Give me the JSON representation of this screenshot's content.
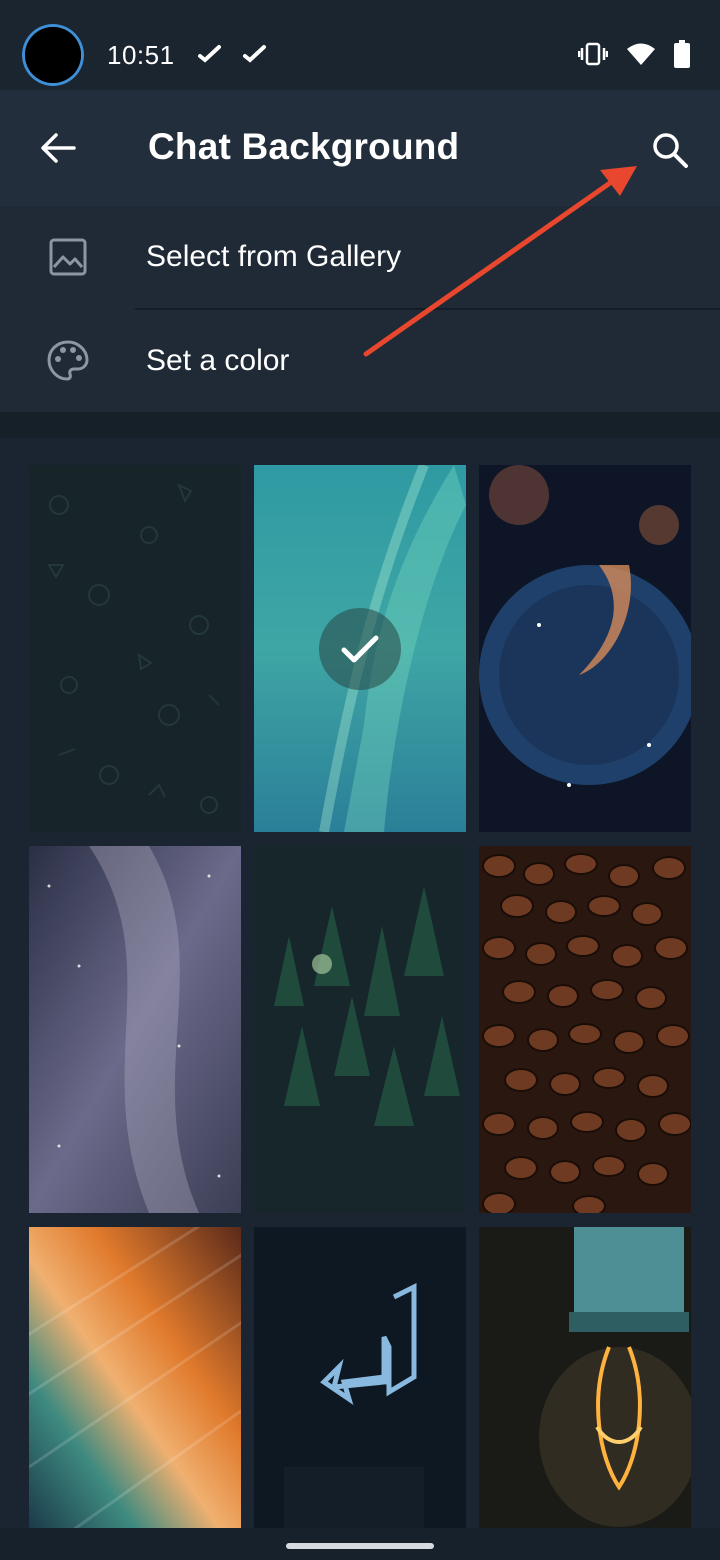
{
  "status_bar": {
    "time": "10:51",
    "icons": [
      "vibrate-icon",
      "wifi-icon",
      "battery-icon"
    ]
  },
  "app_bar": {
    "title": "Chat Background",
    "back_icon": "arrow-left-icon",
    "search_icon": "search-icon"
  },
  "menu": {
    "items": [
      {
        "label": "Select from Gallery",
        "icon": "image-icon"
      },
      {
        "label": "Set a color",
        "icon": "palette-icon"
      }
    ]
  },
  "wallpapers": [
    {
      "name": "dark-pattern",
      "selected": false
    },
    {
      "name": "aurora",
      "selected": true
    },
    {
      "name": "nebula",
      "selected": false
    },
    {
      "name": "milky-way",
      "selected": false
    },
    {
      "name": "forest",
      "selected": false
    },
    {
      "name": "coffee-beans",
      "selected": false
    },
    {
      "name": "color-streaks",
      "selected": false
    },
    {
      "name": "neon-arrow",
      "selected": false
    },
    {
      "name": "light-bulb",
      "selected": false
    }
  ],
  "colors": {
    "background": "#17212b",
    "app_bar": "#232e3c",
    "accent_annotation": "#e8472e"
  }
}
